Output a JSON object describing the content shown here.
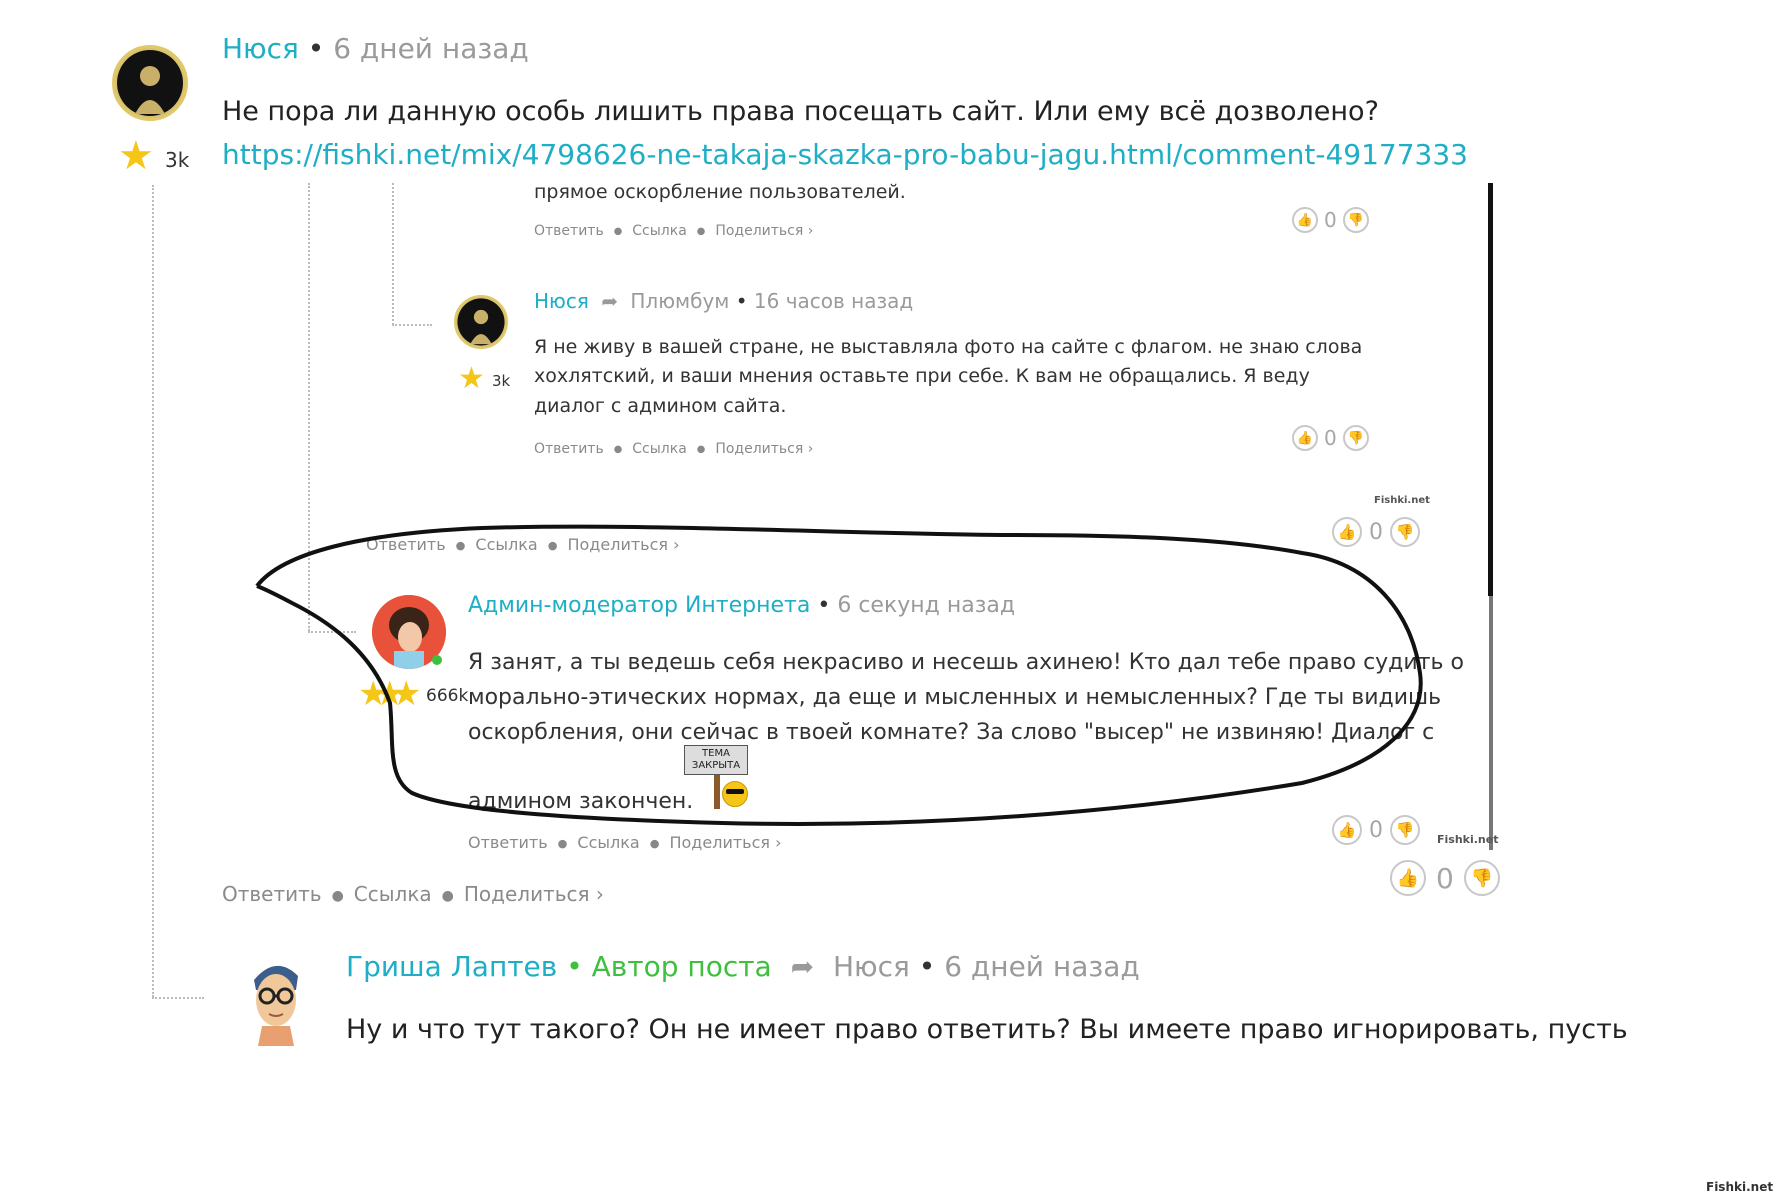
{
  "main_comment": {
    "author": "Нюся",
    "time": "6 дней назад",
    "text": "Не пора ли данную особь лишить права посещать сайт. Или ему всё дозволено?",
    "link": "https://fishki.net/mix/4798626-ne-takaja-skazka-pro-babu-jagu.html/comment-49177333",
    "rating": "3k",
    "actions": {
      "reply": "Ответить",
      "link": "Ссылка",
      "share": "Поделиться ›"
    },
    "votes": "0"
  },
  "embedded": {
    "partial_text": "прямое оскорбление пользователей.",
    "partial_actions": {
      "reply": "Ответить",
      "link": "Ссылка",
      "share": "Поделиться ›"
    },
    "partial_votes": "0",
    "reply1": {
      "author": "Нюся",
      "reply_to": "Плюмбум",
      "time": "16 часов назад",
      "text": "Я не живу в вашей стране, не выставляла фото на сайте с флагом. не знаю слова хохлятский, и ваши мнения оставьте при себе. К вам не обращались. Я веду диалог с админом сайта.",
      "rating": "3k",
      "actions": {
        "reply": "Ответить",
        "link": "Ссылка",
        "share": "Поделиться ›"
      },
      "votes": "0"
    },
    "watermark": "Fishki.net",
    "mid_actions": {
      "reply": "Ответить",
      "link": "Ссылка",
      "share": "Поделиться ›"
    },
    "mid_votes": "0",
    "reply2": {
      "author": "Админ-модератор Интернета",
      "time": "6 секунд назад",
      "text_lines": [
        "Я занят, а ты ведешь себя некрасиво и несешь ахинею! Кто дал тебе право судить о",
        "морально-этических нормах, да еще и мысленных и немысленных? Где ты видишь",
        "оскорбления, они сейчас в твоей комнате? За слово \"высер\" не извиняю! Диалог с",
        "админом закончен."
      ],
      "sign_text": "ТЕМА ЗАКРЫТА",
      "rating": "666k",
      "actions": {
        "reply": "Ответить",
        "link": "Ссылка",
        "share": "Поделиться ›"
      },
      "votes": "0",
      "watermark": "Fishki.net"
    }
  },
  "bottom_comment": {
    "author": "Гриша Лаптев",
    "badge": "Автор поста",
    "reply_to": "Нюся",
    "time": "6 дней назад",
    "text": "Ну и что тут такого? Он не имеет право ответить? Вы имеете право игнорировать, пусть"
  },
  "watermark": "Fishki.net",
  "colors": {
    "link": "#1eaec6",
    "author_badge": "#3fbf3f",
    "star": "#f5c518"
  }
}
